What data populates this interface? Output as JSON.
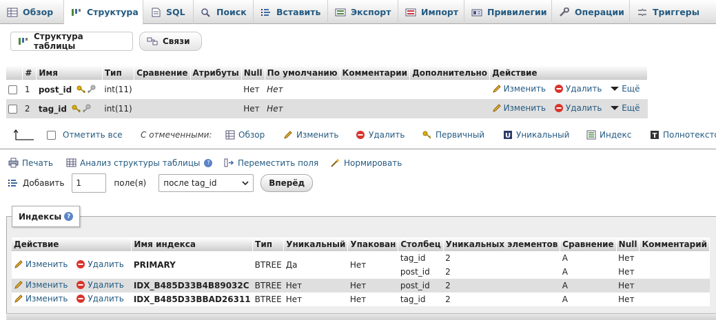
{
  "tabs": [
    {
      "label": "Обзор",
      "icon": "browse-icon",
      "active": false
    },
    {
      "label": "Структура",
      "icon": "structure-icon",
      "active": true
    },
    {
      "label": "SQL",
      "icon": "sql-icon",
      "active": false
    },
    {
      "label": "Поиск",
      "icon": "search-icon",
      "active": false
    },
    {
      "label": "Вставить",
      "icon": "insert-icon",
      "active": false
    },
    {
      "label": "Экспорт",
      "icon": "export-icon",
      "active": false
    },
    {
      "label": "Импорт",
      "icon": "import-icon",
      "active": false
    },
    {
      "label": "Привилегии",
      "icon": "privileges-icon",
      "active": false
    },
    {
      "label": "Операции",
      "icon": "wrench-icon",
      "active": false
    },
    {
      "label": "Триггеры",
      "icon": "triggers-icon",
      "active": false
    }
  ],
  "subtabs": {
    "structure": "Структура таблицы",
    "relations": "Связи"
  },
  "structure_table": {
    "headers": [
      "#",
      "Имя",
      "Тип",
      "Сравнение",
      "Атрибуты",
      "Null",
      "По умолчанию",
      "Комментарии",
      "Дополнительно",
      "Действие"
    ],
    "rows": [
      {
        "num": "1",
        "name": "post_id",
        "type": "int(11)",
        "null": "Нет",
        "default": "Нет"
      },
      {
        "num": "2",
        "name": "tag_id",
        "type": "int(11)",
        "null": "Нет",
        "default": "Нет"
      }
    ],
    "actions": {
      "change": "Изменить",
      "drop": "Удалить",
      "more": "Ещё"
    }
  },
  "with_selected": {
    "check_all": "Отметить все",
    "label": "С отмеченными:",
    "browse": "Обзор",
    "change": "Изменить",
    "drop": "Удалить",
    "primary": "Первичный",
    "unique": "Уникальный",
    "index": "Индекс",
    "fulltext": "Полнотексто"
  },
  "tools": {
    "print": "Печать",
    "analyze": "Анализ структуры таблицы",
    "move": "Переместить поля",
    "normalize": "Нормировать"
  },
  "add_columns": {
    "label": "Добавить",
    "count": "1",
    "fields_label": "поле(я)",
    "position": "после tag_id",
    "go": "Вперёд"
  },
  "indexes": {
    "legend": "Индексы",
    "headers": [
      "Действие",
      "Имя индекса",
      "Тип",
      "Уникальный",
      "Упакован",
      "Столбец",
      "Уникальных элементов",
      "Сравнение",
      "Null",
      "Комментарий"
    ],
    "actions": {
      "change": "Изменить",
      "drop": "Удалить"
    },
    "rows": [
      {
        "name": "PRIMARY",
        "type": "BTREE",
        "unique": "Да",
        "packed": "Нет",
        "cols": [
          {
            "col": "tag_id",
            "card": "2",
            "coll": "A",
            "null": "Нет"
          },
          {
            "col": "post_id",
            "card": "2",
            "coll": "A",
            "null": "Нет"
          }
        ]
      },
      {
        "name": "IDX_B485D33B4B89032C",
        "type": "BTREE",
        "unique": "Нет",
        "packed": "Нет",
        "cols": [
          {
            "col": "post_id",
            "card": "2",
            "coll": "A",
            "null": "Нет"
          }
        ]
      },
      {
        "name": "IDX_B485D33BBAD26311",
        "type": "BTREE",
        "unique": "Нет",
        "packed": "Нет",
        "cols": [
          {
            "col": "tag_id",
            "card": "2",
            "coll": "A",
            "null": "Нет"
          }
        ]
      }
    ]
  },
  "colors": {
    "link": "#235a81",
    "row_alt": "#dfdfdf",
    "drop_red": "#d9342b"
  }
}
